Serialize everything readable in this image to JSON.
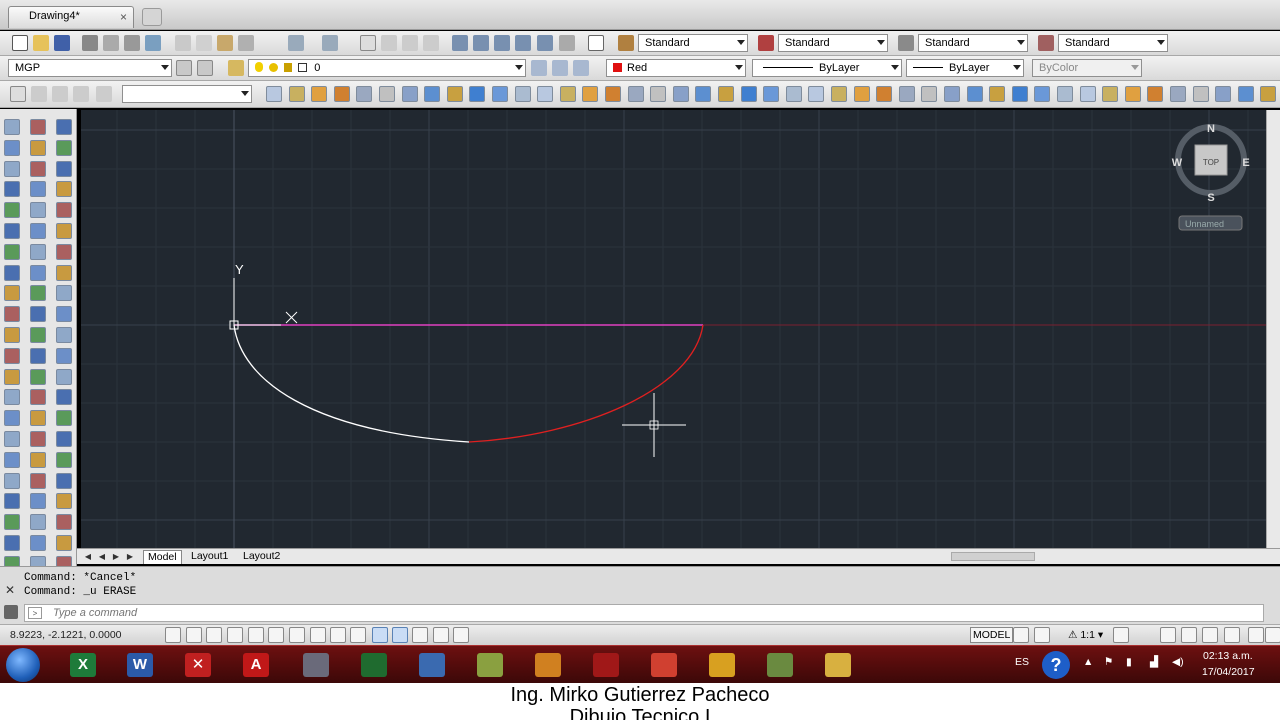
{
  "tabs": {
    "document_tab": "Drawing4*",
    "close_glyph": "×"
  },
  "styles_toolbar": {
    "text_style": "Standard",
    "dim_style": "Standard",
    "table_style": "Standard",
    "mleader_style": "Standard"
  },
  "properties_toolbar": {
    "workspace": "MGP",
    "layer": "0",
    "color": "Red",
    "color_hex": "#e01010",
    "linetype": "ByLayer",
    "lineweight": "ByLayer",
    "plotstyle": "ByColor"
  },
  "viewcube": {
    "north": "N",
    "south": "S",
    "east": "E",
    "west": "W",
    "face": "TOP",
    "ucs_name": "Unnamed"
  },
  "ucs_icon": {
    "y_label": "Y"
  },
  "layout_tabs": [
    {
      "label": "Model"
    },
    {
      "label": "Layout1"
    },
    {
      "label": "Layout2"
    }
  ],
  "command": {
    "history": [
      "Command: *Cancel*",
      "Command: _u ERASE"
    ],
    "placeholder": "Type a command"
  },
  "status": {
    "coordinates": "8.9223, -2.1221, 0.0000",
    "model_label": "MODEL",
    "scale": "1:1"
  },
  "tray": {
    "language": "ES",
    "time": "02:13 a.m.",
    "date": "17/04/2017"
  },
  "caption": {
    "line1": "Ing. Mirko Gutierrez Pacheco",
    "line2": "Dibujo Tecnico I"
  },
  "colors": {
    "canvas": "#212830",
    "grid_minor": "#2b333c",
    "grid_major": "#38414c",
    "arc_white": "#ffffff",
    "arc_red": "#e02020",
    "line_magenta": "#e040c0"
  },
  "icons": {
    "taskbar": [
      "windows-start-icon",
      "excel-icon",
      "word-icon",
      "app-icon",
      "autocad-icon",
      "app-icon",
      "globe-icon",
      "app-icon",
      "folder-icon",
      "app-icon",
      "app-icon",
      "chrome-icon",
      "media-icon",
      "app-icon",
      "explorer-icon"
    ]
  }
}
